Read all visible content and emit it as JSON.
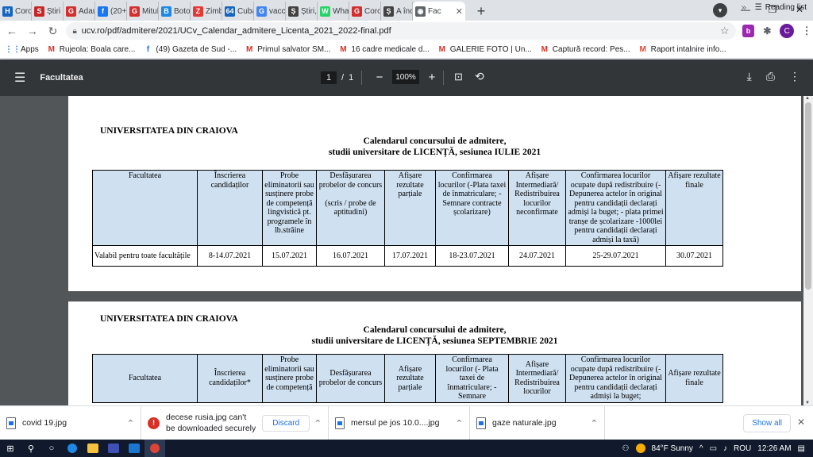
{
  "tabs": [
    {
      "label": "Corona",
      "icon": "H",
      "color": "#1565c0"
    },
    {
      "label": "Știri de",
      "icon": "S",
      "color": "#c62828"
    },
    {
      "label": "Adaugă",
      "icon": "G",
      "color": "#d32f2f"
    },
    {
      "label": "(20+) G",
      "icon": "f",
      "color": "#1877f2"
    },
    {
      "label": "Mitul c",
      "icon": "G",
      "color": "#d32f2f"
    },
    {
      "label": "Botoșa",
      "icon": "B",
      "color": "#1e88e5"
    },
    {
      "label": "Zimbra",
      "icon": "Z",
      "color": "#e53935"
    },
    {
      "label": "Cuba v",
      "icon": "64",
      "color": "#1565c0"
    },
    {
      "label": "vaccin",
      "icon": "G",
      "color": "#4285f4"
    },
    {
      "label": "Știri, ul",
      "icon": "Ș",
      "color": "#424242"
    },
    {
      "label": "WhatsA",
      "icon": "W",
      "color": "#25d366"
    },
    {
      "label": "Corona",
      "icon": "G",
      "color": "#d32f2f"
    },
    {
      "label": "A începe",
      "icon": "Ș",
      "color": "#424242"
    },
    {
      "label": "Fac",
      "icon": "◉",
      "color": "#5f6368",
      "active": true
    }
  ],
  "address": {
    "url": "ucv.ro/pdf/admitere/2021/UCv_Calendar_admitere_Licenta_2021_2022-final.pdf"
  },
  "profile": {
    "initial": "C"
  },
  "bookmarks": [
    {
      "label": "Apps",
      "icon": "⋮⋮",
      "color": "#1a73e8"
    },
    {
      "label": "Rujeola: Boala care...",
      "icon": "M",
      "color": "#d93025"
    },
    {
      "label": "(49) Gazeta de Sud -...",
      "icon": "f",
      "color": "#1877f2"
    },
    {
      "label": "Primul salvator SM...",
      "icon": "M",
      "color": "#d93025"
    },
    {
      "label": "16 cadre medicale d...",
      "icon": "M",
      "color": "#d93025"
    },
    {
      "label": "GALERIE FOTO | Un...",
      "icon": "M",
      "color": "#d93025"
    },
    {
      "label": "Captură record: Pes...",
      "icon": "M",
      "color": "#d93025"
    },
    {
      "label": "Raport intalnire info...",
      "icon": "M",
      "color": "#ea4335"
    }
  ],
  "bookmarks_more": "»",
  "reading_list": "Reading list",
  "pdf_toolbar": {
    "title": "Facultatea",
    "page_current": "1",
    "page_sep": "/",
    "page_total": "1",
    "zoom": "100%"
  },
  "document": {
    "page1": {
      "university": "UNIVERSITATEA DIN CRAIOVA",
      "calendar_line1": "Calendarul concursului de admitere,",
      "calendar_line2": "studii universitare de LICENȚĂ, sesiunea IULIE 2021",
      "headers": [
        "Facultatea",
        "Înscrierea candidaților",
        "Probe eliminatorii sau susținere probe de competență lingvistică pt. programele în lb.străine",
        "Desfășurarea probelor de concurs\n\n(scris / probe de aptitudini)",
        "Afișare rezultate parțiale",
        "Confirmarea locurilor (-Plata taxei de înmatriculare; -Semnare contracte școlarizare)",
        "Afișare Intermediară/ Redistribuirea locurilor neconfirmate",
        "Confirmarea locurilor ocupate după redistribuire (- Depunerea actelor în original pentru candidații declarați admiși la buget; - plata primei tranșe de școlarizare -1000lei pentru candidații declarați admiși la taxă)",
        "Afișare rezultate finale"
      ],
      "row": [
        "Valabil pentru toate facultățile",
        "8-14.07.2021",
        "15.07.2021",
        "16.07.2021",
        "17.07.2021",
        "18-23.07.2021",
        "24.07.2021",
        "25-29.07.2021",
        "30.07.2021"
      ]
    },
    "page2": {
      "university": "UNIVERSITATEA DIN CRAIOVA",
      "calendar_line1": "Calendarul concursului de admitere,",
      "calendar_line2": "studii universitare de LICENȚĂ, sesiunea SEPTEMBRIE  2021",
      "headers": [
        "Facultatea",
        "Înscrierea candidaților*",
        "Probe eliminatorii sau susținere probe de competență",
        "Desfășurarea probelor de concurs",
        "Afișare rezultate parțiale",
        "Confirmarea locurilor (- Plata taxei de înmatriculare; -Semnare",
        "Afișare Intermediară/ Redistribuirea locurilor",
        "Confirmarea locurilor ocupate după redistribuire (- Depunerea actelor în original pentru candidații declarați admiși la buget;",
        "Afișare rezultate finale"
      ]
    }
  },
  "downloads": [
    {
      "name": "covid 19.jpg"
    },
    {
      "error_line1": "decese rusia.jpg can't",
      "error_line2": "be downloaded securely",
      "action": "Discard"
    },
    {
      "name": "mersul pe jos 10.0....jpg"
    },
    {
      "name": "gaze naturale.jpg"
    }
  ],
  "show_all": "Show all",
  "taskbar": {
    "weather": "84°F  Sunny",
    "language": "ROU",
    "time": "12:26 AM"
  }
}
